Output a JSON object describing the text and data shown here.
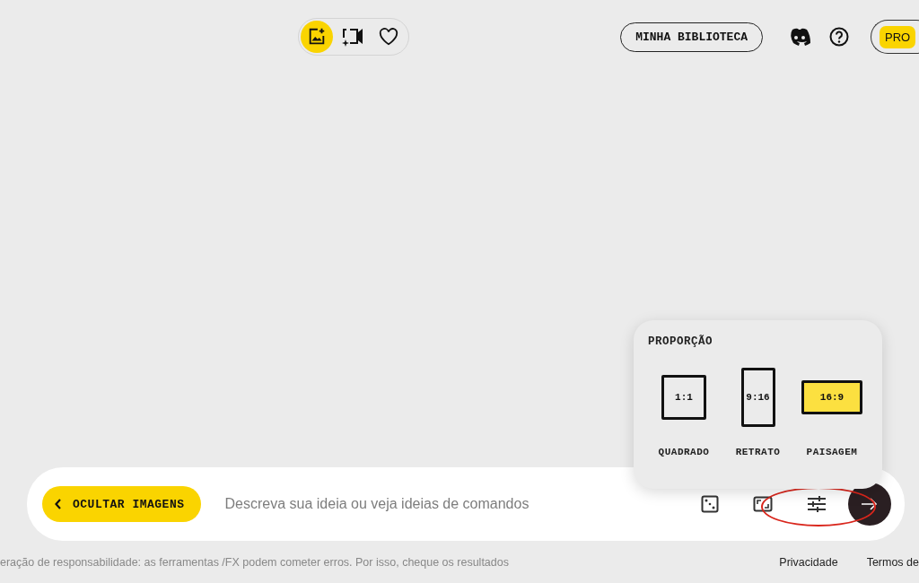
{
  "top_bar": {
    "modes": [
      {
        "kind": "image",
        "selected": true
      },
      {
        "kind": "video",
        "selected": false
      },
      {
        "kind": "favorites",
        "selected": false
      }
    ],
    "library_button": "MINHA BIBLIOTECA",
    "pro_badge": "PRO"
  },
  "aspect_popover": {
    "title": "PROPORÇÃO",
    "options": [
      {
        "kind": "square",
        "ratio": "1:1",
        "label": "QUADRADO",
        "selected": false
      },
      {
        "kind": "portrait",
        "ratio": "9:16",
        "label": "RETRATO",
        "selected": false
      },
      {
        "kind": "landscape",
        "ratio": "16:9",
        "label": "PAISAGEM",
        "selected": true
      }
    ]
  },
  "prompt_bar": {
    "hide_button": "OCULTAR IMAGENS",
    "placeholder": "Descreva sua ideia ou veja ideias de comandos"
  },
  "footer": {
    "disclaimer": "eração de responsabilidade: as ferramentas /FX podem cometer erros. Por isso, cheque os resultados",
    "links": [
      "Privacidade",
      "Termos de"
    ]
  }
}
